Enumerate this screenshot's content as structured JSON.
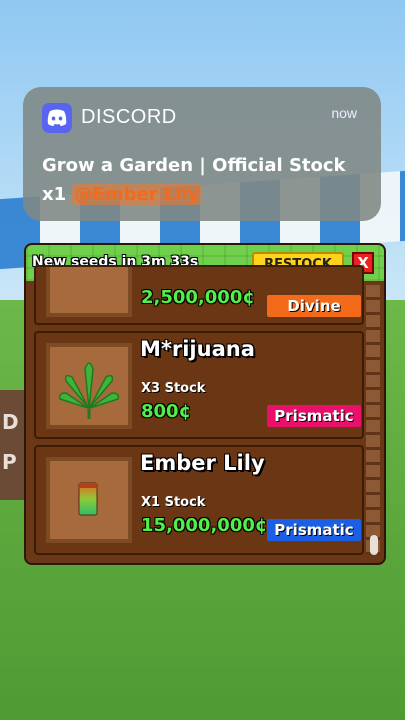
{
  "notification": {
    "app_name": "DISCORD",
    "time": "now",
    "title": "Grow a Garden | Official Stock",
    "body_prefix": "x1",
    "mention": "@Ember Lily"
  },
  "shop": {
    "restock_timer": "New seeds in 3m 33s",
    "restock_label": "RESTOCK",
    "close_label": "X",
    "items": [
      {
        "name": "",
        "stock": "",
        "price": "2,500,000¢",
        "rarity": "Divine",
        "rarity_color": "#f26a1a"
      },
      {
        "name": "M*rijuana",
        "stock": "X3 Stock",
        "price": "800¢",
        "rarity": "Prismatic",
        "rarity_color": "#e8106a"
      },
      {
        "name": "Ember Lily",
        "stock": "X1 Stock",
        "price": "15,000,000¢",
        "rarity": "Prismatic",
        "rarity_color": "#1b5fe6"
      }
    ]
  }
}
